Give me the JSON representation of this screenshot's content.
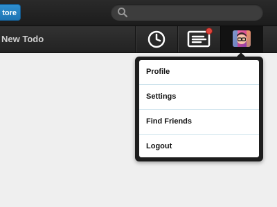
{
  "topbar": {
    "store_label": "tore",
    "search": {
      "placeholder": "",
      "icon": "search-icon"
    }
  },
  "toolbar": {
    "new_todo_label": "New Todo",
    "buttons": [
      {
        "icon": "clock-icon"
      },
      {
        "icon": "messages-icon",
        "has_notification": true
      },
      {
        "icon": "avatar"
      }
    ]
  },
  "user_menu": {
    "items": [
      {
        "label": "Profile"
      },
      {
        "label": "Settings"
      },
      {
        "label": "Find Friends"
      },
      {
        "label": "Logout"
      }
    ]
  },
  "colors": {
    "accent": "#2282c4",
    "notification": "#e0443c",
    "bar_dark": "#222222",
    "menu_divider": "#cde3ec"
  }
}
